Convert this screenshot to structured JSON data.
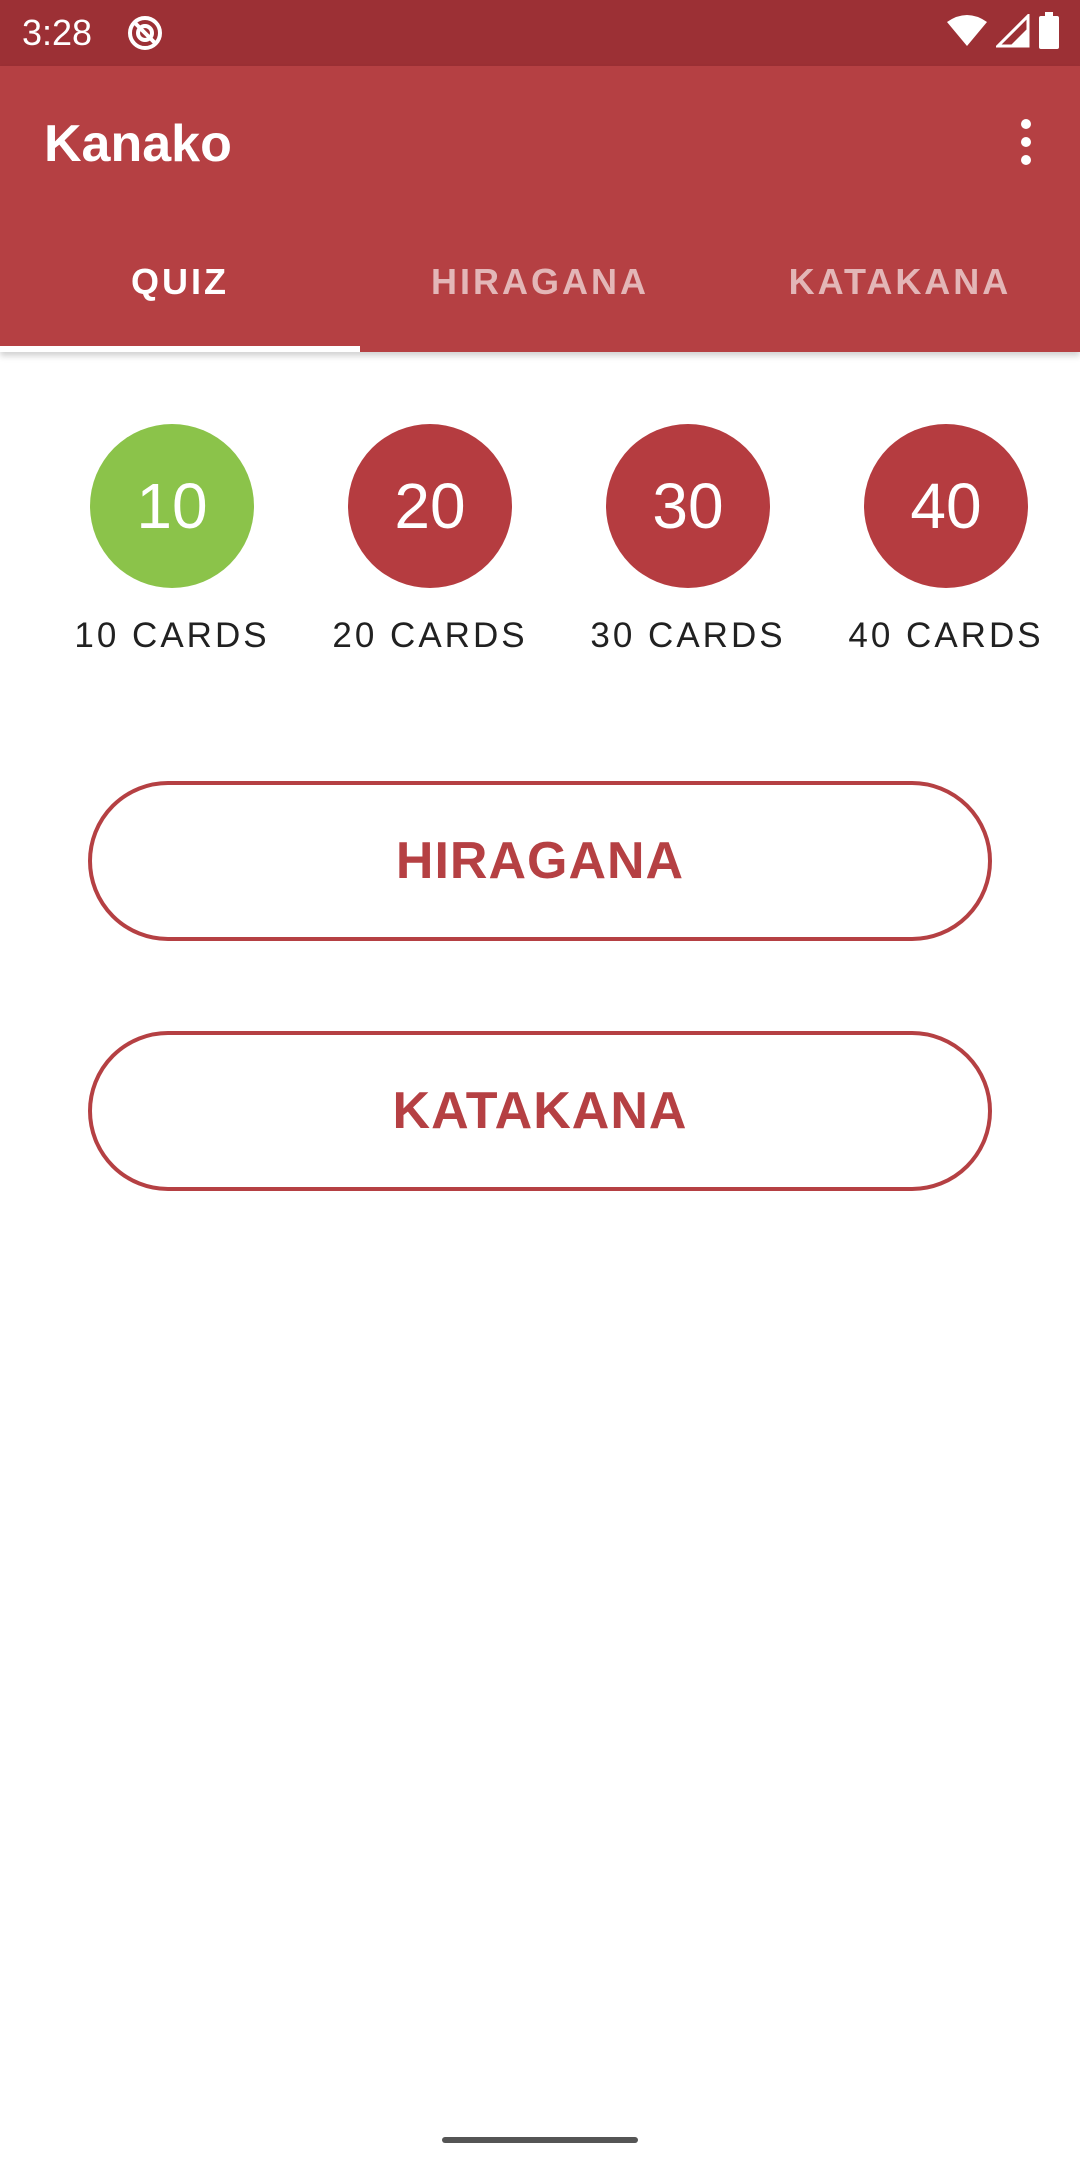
{
  "status_bar": {
    "time": "3:28",
    "icons": [
      "do-not-disturb-icon",
      "wifi-icon",
      "cellular-signal-icon",
      "battery-icon"
    ]
  },
  "app_bar": {
    "title": "Kanako",
    "menu_icon": "more-vert-icon"
  },
  "tabs": [
    {
      "label": "QUIZ",
      "active": true
    },
    {
      "label": "HIRAGANA",
      "active": false
    },
    {
      "label": "KATAKANA",
      "active": false
    }
  ],
  "card_options": [
    {
      "number": "10",
      "label": "10 CARDS",
      "selected": true
    },
    {
      "number": "20",
      "label": "20 CARDS",
      "selected": false
    },
    {
      "number": "30",
      "label": "30 CARDS",
      "selected": false
    },
    {
      "number": "40",
      "label": "40 CARDS",
      "selected": false
    }
  ],
  "buttons": {
    "hiragana": "HIRAGANA",
    "katakana": "KATAKANA"
  },
  "colors": {
    "status_bar": "#9c3035",
    "primary": "#b54043",
    "selected": "#8bc34a"
  }
}
